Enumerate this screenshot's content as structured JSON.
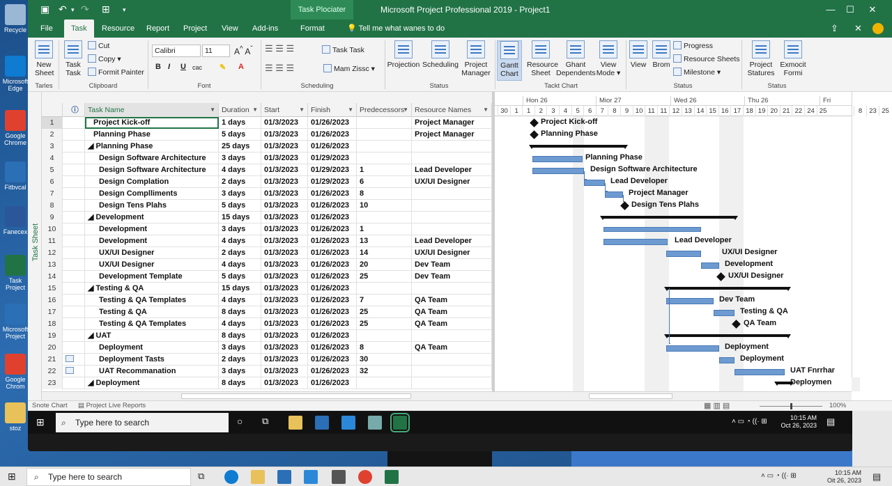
{
  "desktop": {
    "icons": [
      {
        "label": "Recycle",
        "icon": "recycle-bin-icon",
        "color": "#9ab7d6"
      },
      {
        "label": "Microsoft Edge",
        "icon": "edge-icon",
        "color": "#0f7bd1"
      },
      {
        "label": "Google Chrome",
        "icon": "chrome-icon",
        "color": "#e0412f"
      },
      {
        "label": "Fitbvcal",
        "icon": "app-icon",
        "color": "#2b6fb6"
      },
      {
        "label": "Fanecex",
        "icon": "word-icon",
        "color": "#2b579a"
      },
      {
        "label": "Task Project",
        "icon": "project-icon",
        "color": "#217346"
      },
      {
        "label": "Microsoft Project",
        "icon": "project-icon",
        "color": "#2b6fb6"
      },
      {
        "label": "Google Chrom",
        "icon": "chrome-icon",
        "color": "#e0412f"
      },
      {
        "label": "stoz",
        "icon": "folder-icon",
        "color": "#e8c15a"
      }
    ]
  },
  "titlebar": {
    "context_tab": "Task Plociater",
    "title": "Microsoft Project Professional 2019  -  Project1",
    "min": "—",
    "max": "☐",
    "close": "✕"
  },
  "tabs": [
    "File",
    "Task",
    "Resource",
    "Report",
    "Project",
    "View",
    "Add-ins",
    "Format"
  ],
  "tell_me": "Tell me what wanes to do",
  "ribbon": {
    "groups": [
      "Tarles",
      "Clipboard",
      "Font",
      "Scheduling",
      "Status",
      "Tackt Chart",
      "Status",
      "Status"
    ],
    "new_sheet": "New Sheet",
    "task_task": "Task Task",
    "cut": "Cut",
    "copy": "Copy",
    "format_painter": "Formit Painter",
    "font_name": "Calibri",
    "font_size": "11",
    "bold": "B",
    "italic": "I",
    "underline": "U",
    "cac": "cac",
    "task_task2": "Task Task",
    "mam_zissc": "Mam Zissc",
    "projection": "Projection",
    "scheduling": "Scheduling",
    "project_manager": "Project Manager",
    "gantt_chart": "Gantt Chart",
    "resource_sheet": "Resource Sheet",
    "ghant_dependents": "Ghant Dependents",
    "view_mode": "View Mode",
    "view": "View",
    "brom": "Brom",
    "progress": "Progress",
    "resource_sheets": "Resource Sheets",
    "milestone": "Milestone",
    "project_statures": "Project Statures",
    "exmocit_formi": "Exmocit Formi"
  },
  "grid": {
    "headers": [
      "Task Name",
      "Duration",
      "Start",
      "Finish",
      "Predecessors",
      "Resource Names"
    ],
    "rows": [
      {
        "id": "1",
        "name": "Project Kick-off",
        "indent": 1,
        "dur": "1 days",
        "start": "01/3/2023",
        "finish": "01/26/2023",
        "pred": "",
        "res": "Project Manager"
      },
      {
        "id": "2",
        "name": "Planning Phase",
        "indent": 1,
        "dur": "5 days",
        "start": "01/3/2023",
        "finish": "01/26/2023",
        "pred": "",
        "res": "Project Manager"
      },
      {
        "id": "3",
        "name": "◢ Planning Phase",
        "indent": 0,
        "dur": "25 days",
        "start": "01/3/2023",
        "finish": "01/26/2023",
        "pred": "",
        "res": ""
      },
      {
        "id": "4",
        "name": "Design Software Architecture",
        "indent": 2,
        "dur": "3 days",
        "start": "01/3/2023",
        "finish": "01/29/2023",
        "pred": "",
        "res": ""
      },
      {
        "id": "5",
        "name": "Design Software Architecture",
        "indent": 2,
        "dur": "4 days",
        "start": "01/3/2023",
        "finish": "01/29/2023",
        "pred": "1",
        "res": "Lead Developer"
      },
      {
        "id": "6",
        "name": "Design Complation",
        "indent": 2,
        "dur": "2 days",
        "start": "01/3/2023",
        "finish": "01/29/2023",
        "pred": "6",
        "res": "UX/UI Designer"
      },
      {
        "id": "7",
        "name": "Design Complliments",
        "indent": 2,
        "dur": "3 days",
        "start": "01/3/2023",
        "finish": "01/26/2023",
        "pred": "8",
        "res": ""
      },
      {
        "id": "8",
        "name": "Design Tens Plahs",
        "indent": 2,
        "dur": "5 days",
        "start": "01/3/2023",
        "finish": "01/26/2023",
        "pred": "10",
        "res": ""
      },
      {
        "id": "9",
        "name": "◢ Development",
        "indent": 0,
        "dur": "15 days",
        "start": "01/3/2023",
        "finish": "01/26/2023",
        "pred": "",
        "res": ""
      },
      {
        "id": "10",
        "name": "Development",
        "indent": 2,
        "dur": "3 days",
        "start": "01/3/2023",
        "finish": "01/26/2023",
        "pred": "1",
        "res": ""
      },
      {
        "id": "11",
        "name": "Development",
        "indent": 2,
        "dur": "4 days",
        "start": "01/3/2023",
        "finish": "01/26/2023",
        "pred": "13",
        "res": "Lead Developer"
      },
      {
        "id": "12",
        "name": "UX/UI Designer",
        "indent": 2,
        "dur": "2 days",
        "start": "01/3/2023",
        "finish": "01/26/2023",
        "pred": "14",
        "res": "UX/UI Designer"
      },
      {
        "id": "13",
        "name": "UX/UI Designer",
        "indent": 2,
        "dur": "4 days",
        "start": "01/3/2023",
        "finish": "01/26/2023",
        "pred": "20",
        "res": "Dev Team"
      },
      {
        "id": "14",
        "name": "Development Template",
        "indent": 2,
        "dur": "5 days",
        "start": "01/3/2023",
        "finish": "01/26/2023",
        "pred": "25",
        "res": "Dev Team"
      },
      {
        "id": "15",
        "name": "◢ Testing & QA",
        "indent": 0,
        "dur": "15 days",
        "start": "01/3/2023",
        "finish": "01/26/2023",
        "pred": "",
        "res": ""
      },
      {
        "id": "16",
        "name": "Testing & QA Templates",
        "indent": 2,
        "dur": "4 days",
        "start": "01/3/2023",
        "finish": "01/26/2023",
        "pred": "7",
        "res": "QA Team"
      },
      {
        "id": "17",
        "name": "Testing & QA",
        "indent": 2,
        "dur": "8 days",
        "start": "01/3/2023",
        "finish": "01/26/2023",
        "pred": "25",
        "res": "QA Team"
      },
      {
        "id": "18",
        "name": "Testing & QA Templates",
        "indent": 2,
        "dur": "4 days",
        "start": "01/3/2023",
        "finish": "01/26/2023",
        "pred": "25",
        "res": "QA Team"
      },
      {
        "id": "19",
        "name": "◢ UAT",
        "indent": 0,
        "dur": "8 days",
        "start": "01/3/2023",
        "finish": "01/26/2023",
        "pred": "",
        "res": ""
      },
      {
        "id": "20",
        "name": "Deployment",
        "indent": 2,
        "dur": "3 days",
        "start": "01/3/2023",
        "finish": "01/26/2023",
        "pred": "8",
        "res": "QA Team"
      },
      {
        "id": "21",
        "name": "Deployment Tasts",
        "indent": 2,
        "dur": "2 days",
        "start": "01/3/2023",
        "finish": "01/26/2023",
        "pred": "30",
        "res": "",
        "icon": true
      },
      {
        "id": "22",
        "name": "UAT Recommanation",
        "indent": 2,
        "dur": "3 days",
        "start": "01/3/2023",
        "finish": "01/26/2023",
        "pred": "32",
        "res": "",
        "icon": true
      },
      {
        "id": "23",
        "name": "◢ Deployment",
        "indent": 0,
        "dur": "8 days",
        "start": "01/3/2023",
        "finish": "01/26/2023",
        "pred": "",
        "res": ""
      }
    ]
  },
  "gantt": {
    "weeks": [
      "Hon 26",
      "Mior 27",
      "Wed 26",
      "Thu 26",
      "Fri"
    ],
    "days": [
      "30",
      "1",
      "1",
      "2",
      "3",
      "4",
      "5",
      "6",
      "7",
      "8",
      "9",
      "10",
      "11",
      "11",
      "12",
      "13",
      "14",
      "15",
      "16",
      "17",
      "18",
      "19",
      "20",
      "21",
      "22",
      "24",
      "25"
    ],
    "right_days": [
      "8",
      "23",
      "25"
    ],
    "labels": [
      "Project Kick-off",
      "Planning Phase",
      "Planning Phase",
      "Design Software Architecture",
      "Lead Developer",
      "Project Manager",
      "Design Tens Plahs",
      "Lead Developer",
      "UX/UI Designer",
      "Development",
      "UX/UI Designer",
      "Dev Team",
      "Testing & QA",
      "QA Team",
      "Deployment",
      "Deployment",
      "UAT Fnrrhar",
      "Deploymen"
    ]
  },
  "statusbar": {
    "left": "Snote Chart",
    "right": "Project Live Reports",
    "zoom": "100%"
  },
  "inner_taskbar": {
    "search": "Type here to search",
    "time": "10:15 AM",
    "date": "Oct 26, 2023"
  },
  "outer_taskbar": {
    "search": "Type here to search",
    "time": "10:15 AM",
    "date": "Oit 26, 2023"
  }
}
